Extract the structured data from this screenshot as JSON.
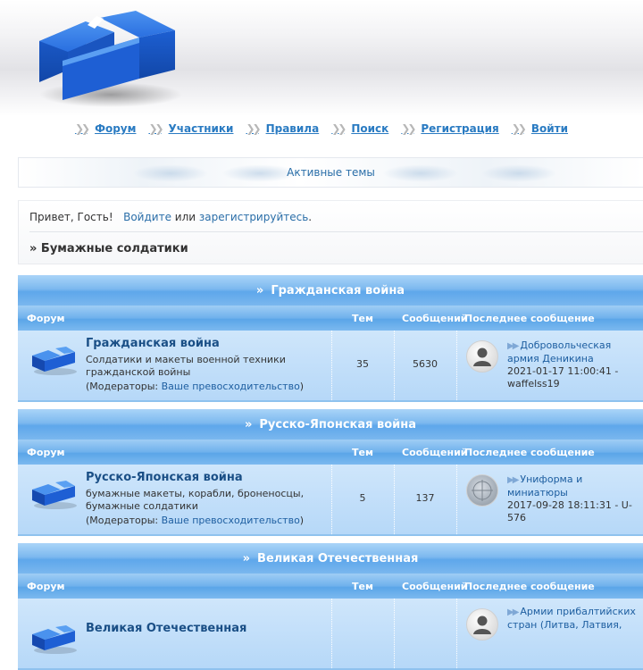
{
  "nav": {
    "items": [
      {
        "label": "Форум"
      },
      {
        "label": "Участники"
      },
      {
        "label": "Правила"
      },
      {
        "label": "Поиск"
      },
      {
        "label": "Регистрация"
      },
      {
        "label": "Войти"
      }
    ]
  },
  "active_topics": {
    "label": "Активные темы"
  },
  "greeting": {
    "prefix": "Привет, Гость!",
    "login_link": "Войдите",
    "or": "или",
    "register_link": "зарегистрируйтесь",
    "suffix": "."
  },
  "breadcrumb": "» Бумажные солдатики",
  "columns": {
    "forum": "Форум",
    "topics": "Тем",
    "posts": "Сообщений",
    "last": "Последнее сообщение"
  },
  "categories": [
    {
      "title": "Гражданская война",
      "forum": {
        "name": "Гражданская война",
        "description": "Солдатики и макеты военной техники гражданской войны",
        "mods_label": "Модераторы:",
        "mods_name": "Ваше превосходительство",
        "topics": "35",
        "posts": "5630",
        "last_title": "Добровольческая армия Деникина",
        "last_meta": "2021-01-17 11:00:41 - waffelss19"
      }
    },
    {
      "title": "Русско-Японская война",
      "forum": {
        "name": "Русско-Японская война",
        "description": "бумажные макеты, корабли, броненосцы, бумажные солдатики",
        "mods_label": "Модераторы:",
        "mods_name": "Ваше превосходительство",
        "topics": "5",
        "posts": "137",
        "last_title": "Униформа и миниатюры",
        "last_meta": "2017-09-28 18:11:31 - U-576"
      }
    },
    {
      "title": "Великая Отечественная",
      "forum": {
        "name": "Великая Отечественная",
        "description": "",
        "mods_label": "",
        "mods_name": "",
        "topics": "",
        "posts": "",
        "last_title": "Армии прибалтийских стран (Литва, Латвия,",
        "last_meta": ""
      }
    }
  ],
  "colors": {
    "link": "#2a7bc2",
    "category_header": "#6fb1ec",
    "row_bg": "#b6d8f8"
  },
  "icons": [
    "site-logo-icon",
    "double-chevron-icon",
    "forum-folder-icon",
    "user-avatar-icon",
    "last-post-arrow-icon"
  ]
}
